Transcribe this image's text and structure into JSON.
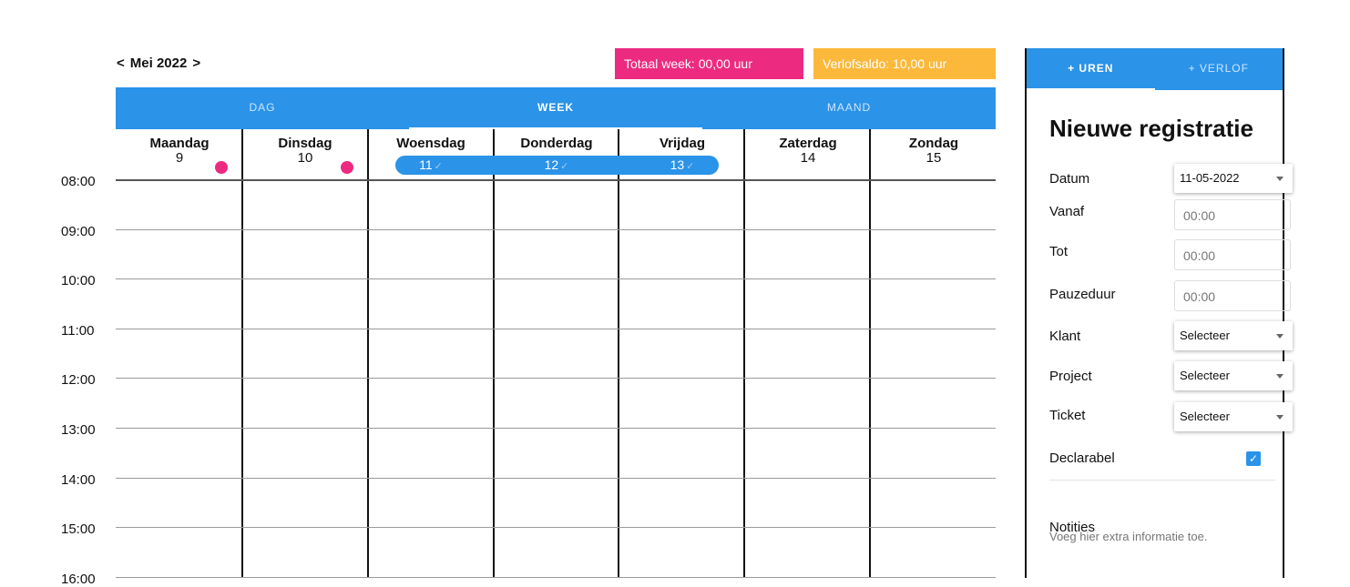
{
  "header": {
    "prev": "<",
    "month": "Mei 2022",
    "next": ">",
    "total_week": "Totaal week: 00,00 uur",
    "verlofsaldo": "Verlofsaldo: 10,00 uur"
  },
  "views": [
    "DAG",
    "WEEK",
    "MAAND"
  ],
  "active_view": "WEEK",
  "days": [
    {
      "name": "Maandag",
      "num": "9",
      "dot": true
    },
    {
      "name": "Dinsdag",
      "num": "10",
      "dot": true
    },
    {
      "name": "Woensdag",
      "num": "11",
      "highlight": true
    },
    {
      "name": "Donderdag",
      "num": "12",
      "highlight": true
    },
    {
      "name": "Vrijdag",
      "num": "13",
      "highlight": true
    },
    {
      "name": "Zaterdag",
      "num": "14"
    },
    {
      "name": "Zondag",
      "num": "15"
    }
  ],
  "check_glyph": "✓",
  "times": [
    "08:00",
    "09:00",
    "10:00",
    "11:00",
    "12:00",
    "13:00",
    "14:00",
    "15:00",
    "16:00"
  ],
  "panel": {
    "tabs": [
      "+ UREN",
      "+ VERLOF"
    ],
    "title": "Nieuwe registratie",
    "datum_label": "Datum",
    "datum_value": "11-05-2022",
    "vanaf_label": "Vanaf",
    "vanaf_value": "00:00",
    "tot_label": "Tot",
    "tot_value": "00:00",
    "pauze_label": "Pauzeduur",
    "pauze_value": "00:00",
    "klant_label": "Klant",
    "klant_value": "Selecteer",
    "project_label": "Project",
    "project_value": "Selecteer",
    "ticket_label": "Ticket",
    "ticket_value": "Selecteer",
    "declarabel_label": "Declarabel",
    "declarabel_checked": true,
    "check_mark": "✓",
    "notities_label": "Notities",
    "notities_placeholder": "Voeg hier extra informatie toe."
  },
  "colors": {
    "primary": "#2b93e8",
    "pink": "#ec2b80",
    "orange": "#fcb83a"
  }
}
